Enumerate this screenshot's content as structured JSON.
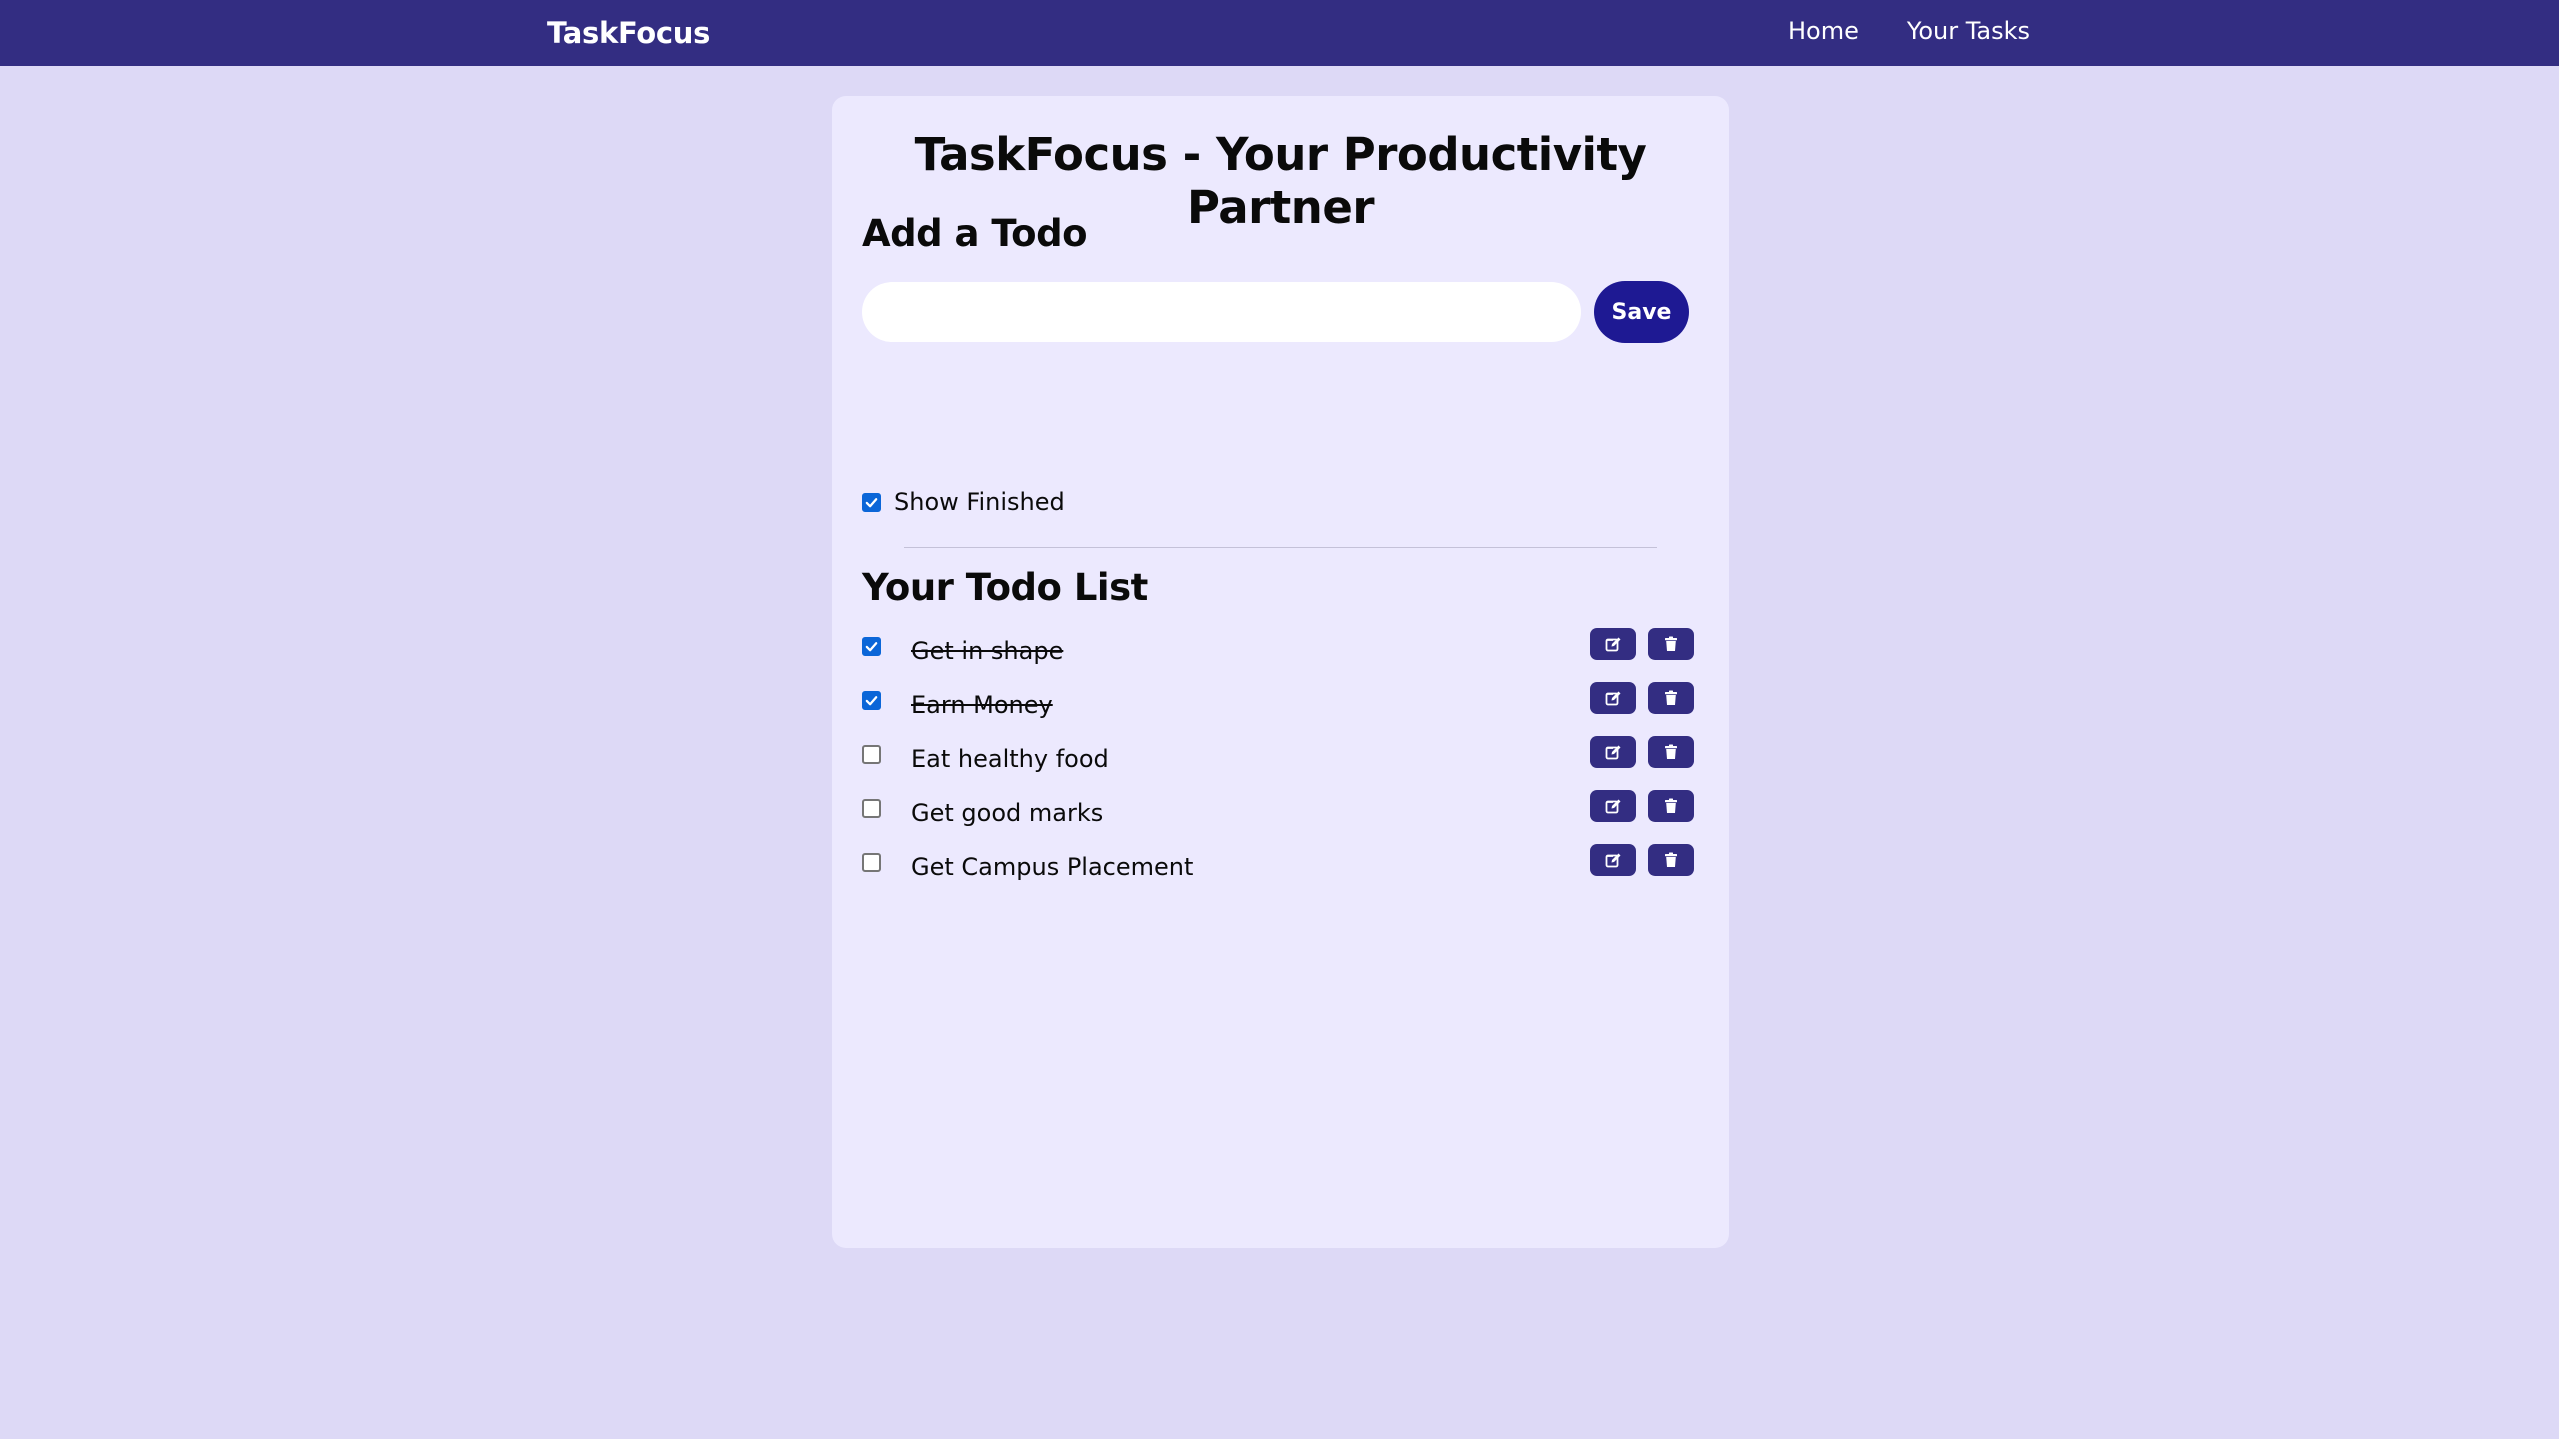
{
  "navbar": {
    "brand": "TaskFocus",
    "links": [
      "Home",
      "Your Tasks"
    ]
  },
  "main": {
    "title": "TaskFocus - Your Productivity Partner",
    "add_heading": "Add a Todo",
    "input_value": "",
    "save_label": "Save",
    "show_finished_label": "Show Finished",
    "show_finished_checked": true,
    "list_heading": "Your Todo List",
    "todos": [
      {
        "text": "Get in shape",
        "done": true
      },
      {
        "text": "Earn Money",
        "done": true
      },
      {
        "text": "Eat healthy food",
        "done": false
      },
      {
        "text": "Get good marks",
        "done": false
      },
      {
        "text": "Get Campus Placement",
        "done": false
      }
    ]
  },
  "icons": {
    "edit": "edit-icon",
    "delete": "trash-icon",
    "check": "checkmark-icon"
  },
  "colors": {
    "navbar": "#332d82",
    "page_bg": "#ddd9f6",
    "card_bg": "#ece9fe",
    "save_button": "#1e1993",
    "icon_button": "#332d82",
    "checkbox_checked": "#0b66d8"
  }
}
